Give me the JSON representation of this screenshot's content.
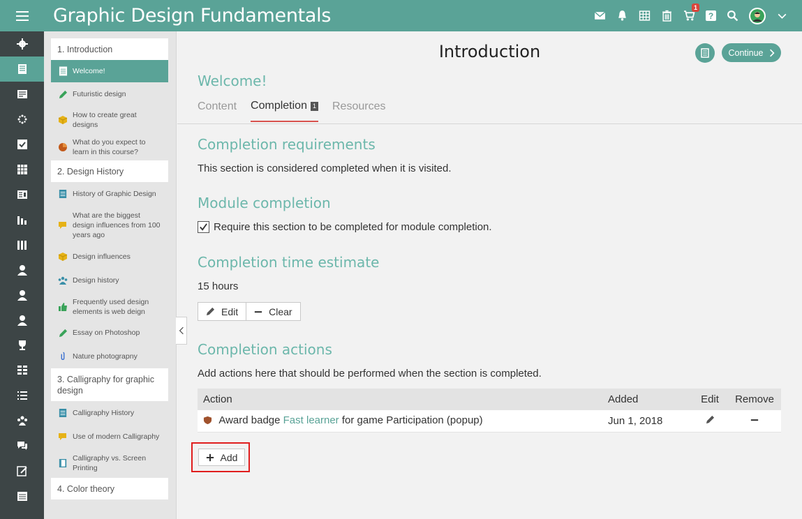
{
  "header": {
    "title": "Graphic Design Fundamentals",
    "cart_badge": "1",
    "help_label": "?"
  },
  "rail": [
    "settings-icon",
    "course-icon",
    "catalog-icon",
    "sun-icon",
    "checklist-icon",
    "calendar-icon",
    "reports-icon",
    "chart-icon",
    "library-icon",
    "user-icon",
    "instructor-icon",
    "learner-icon",
    "trophy-icon",
    "grid-icon",
    "list-icon",
    "groups-icon",
    "chat-icon",
    "edit-icon",
    "calendar2-icon"
  ],
  "outline": {
    "sections": [
      {
        "label": "1. Introduction"
      },
      {
        "label": "2. Design History"
      },
      {
        "label": "3. Calligraphy for graphic design"
      },
      {
        "label": "4. Color theory"
      }
    ],
    "items": [
      {
        "label": "Welcome!",
        "icon": "document-icon"
      },
      {
        "label": "Futuristic design",
        "icon": "pencil-icon"
      },
      {
        "label": "How to create great designs",
        "icon": "box-icon"
      },
      {
        "label": "What do you expect to learn in this course?",
        "icon": "pie-chart-icon"
      },
      {
        "label": "History of Graphic Design",
        "icon": "document-icon"
      },
      {
        "label": "What are the biggest design influences from 100 years ago",
        "icon": "chat-icon"
      },
      {
        "label": "Design influences",
        "icon": "box-icon"
      },
      {
        "label": "Design history",
        "icon": "group-icon"
      },
      {
        "label": "Frequently used design elements is web deign",
        "icon": "thumbs-up-icon"
      },
      {
        "label": "Essay on Photoshop",
        "icon": "pencil-icon"
      },
      {
        "label": "Nature photograpny",
        "icon": "paperclip-icon"
      },
      {
        "label": "Calligraphy History",
        "icon": "document-icon"
      },
      {
        "label": "Use of modern Calligraphy",
        "icon": "chat-icon"
      },
      {
        "label": "Calligraphy vs. Screen Printing",
        "icon": "book-icon"
      }
    ]
  },
  "main": {
    "title": "Introduction",
    "continue_label": "Continue",
    "unit_title": "Welcome!",
    "tabs": [
      {
        "label": "Content"
      },
      {
        "label": "Completion",
        "count": "1"
      },
      {
        "label": "Resources"
      }
    ],
    "requirements": {
      "heading": "Completion requirements",
      "text": "This section is considered completed when it is visited."
    },
    "module": {
      "heading": "Module completion",
      "checkbox_label": "Require this section to be completed for module completion."
    },
    "time": {
      "heading": "Completion time estimate",
      "value": "15 hours",
      "edit_label": "Edit",
      "clear_label": "Clear"
    },
    "actions": {
      "heading": "Completion actions",
      "text": "Add actions here that should be performed when the section is completed.",
      "columns": [
        "Action",
        "Added",
        "Edit",
        "Remove"
      ],
      "rows": [
        {
          "prefix": "Award badge",
          "link": "Fast learner",
          "suffix": "for game Participation (popup)",
          "added": "Jun 1, 2018"
        }
      ],
      "add_label": "Add"
    }
  }
}
